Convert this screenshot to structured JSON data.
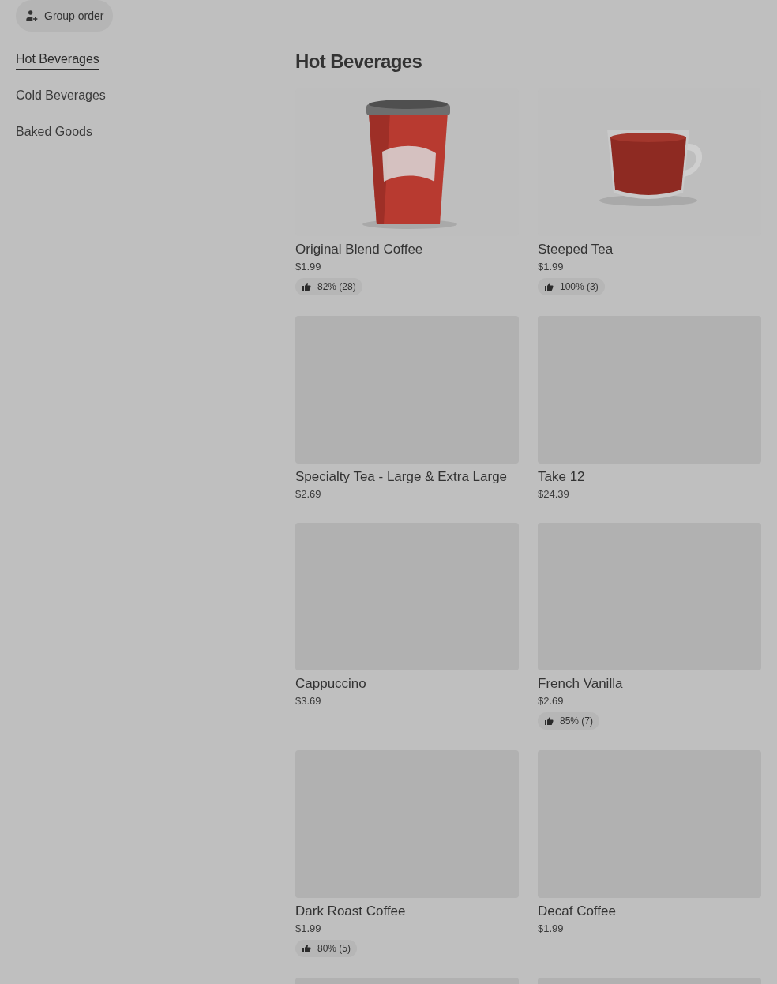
{
  "group_order_button": {
    "label": "Group order"
  },
  "categories": [
    {
      "label": "Hot Beverages",
      "selected": true
    },
    {
      "label": "Cold Beverages",
      "selected": false
    },
    {
      "label": "Baked Goods",
      "selected": false
    }
  ],
  "section": {
    "title": "Hot Beverages"
  },
  "items": [
    {
      "kind": "picture",
      "name": "Original Blend Coffee",
      "price": "$1.99",
      "rating": "82% (28)"
    },
    {
      "kind": "picture",
      "name": "Steeped Tea",
      "price": "$1.99",
      "rating": "100% (3)"
    },
    {
      "kind": "placeholder",
      "name": "Specialty Tea - Large & Extra Large",
      "price": "$2.69"
    },
    {
      "kind": "placeholder",
      "name": "Take 12",
      "price": "$24.39"
    },
    {
      "kind": "placeholder",
      "name": "Cappuccino",
      "price": "$3.69"
    },
    {
      "kind": "placeholder",
      "name": "French Vanilla",
      "price": "$2.69",
      "rating": "85% (7)"
    },
    {
      "kind": "placeholder",
      "name": "Dark Roast Coffee",
      "price": "$1.99",
      "rating": "80% (5)"
    },
    {
      "kind": "placeholder",
      "name": "Decaf Coffee",
      "price": "$1.99"
    },
    {
      "kind": "placeholder"
    },
    {
      "kind": "placeholder"
    }
  ]
}
